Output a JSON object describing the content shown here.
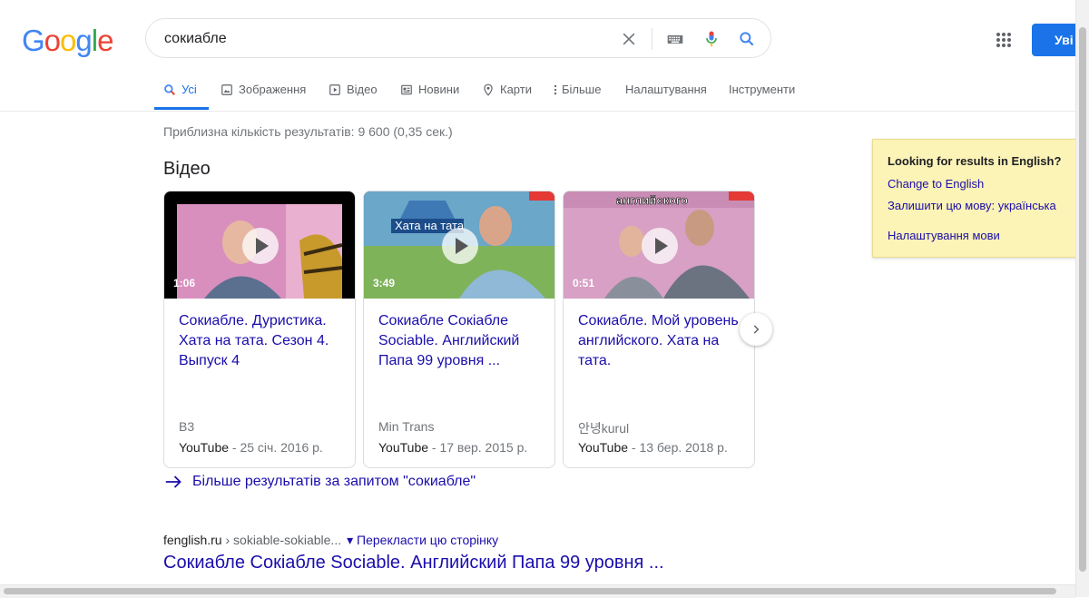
{
  "logo": {
    "letters": [
      "G",
      "o",
      "o",
      "g",
      "l",
      "e"
    ],
    "colors": [
      "#4285f4",
      "#ea4335",
      "#fbbc05",
      "#4285f4",
      "#34a853",
      "#ea4335"
    ]
  },
  "search": {
    "query": "сокиабле"
  },
  "header": {
    "signin_label": "Уві"
  },
  "tabs": [
    {
      "label": "Усі",
      "icon": "search-icon"
    },
    {
      "label": "Зображення",
      "icon": "image-icon"
    },
    {
      "label": "Відео",
      "icon": "play-icon"
    },
    {
      "label": "Новини",
      "icon": "news-icon"
    },
    {
      "label": "Карти",
      "icon": "map-pin-icon"
    },
    {
      "label": "Більше",
      "icon": "more-vert-icon"
    },
    {
      "label": "Налаштування"
    },
    {
      "label": "Інструменти"
    }
  ],
  "stats": "Приблизна кількість результатів: 9 600 (0,35 сек.)",
  "videos_heading": "Відео",
  "videos": [
    {
      "duration": "1:06",
      "title": "Сокиабле. Дуристика. Хата на тата. Сезон 4. Выпуск 4",
      "channel": "В3",
      "source": "YouTube",
      "date": " - 25 січ. 2016 р."
    },
    {
      "duration": "3:49",
      "title": "Сокиабле Сокіабле Sociable. Английский Папа 99 уровня ...",
      "channel": "Min Trans",
      "source": "YouTube",
      "date": " - 17 вер. 2015 р."
    },
    {
      "duration": "0:51",
      "title": "Сокиабле. Мой уровень английского. Хата на тата.",
      "channel": "안녕kurul",
      "source": "YouTube",
      "date": " - 13 бер. 2018 р."
    }
  ],
  "thumb_text": {
    "t2": "Хата на тата",
    "t3": "английского"
  },
  "more_results": "Більше результатів за запитом \"сокиабле\"",
  "result": {
    "domain": "fenglish.ru",
    "crumb": " › sokiable-sokiable...",
    "translate": "▾ Перекласти цю сторінку",
    "title": "Сокиабле Сокіабле Sociable. Английский Папа 99 уровня ..."
  },
  "lang_panel": {
    "heading": "Looking for results in English?",
    "link1": "Change to English",
    "link2": "Залишити цю мову: українська",
    "link3": "Налаштування мови"
  }
}
